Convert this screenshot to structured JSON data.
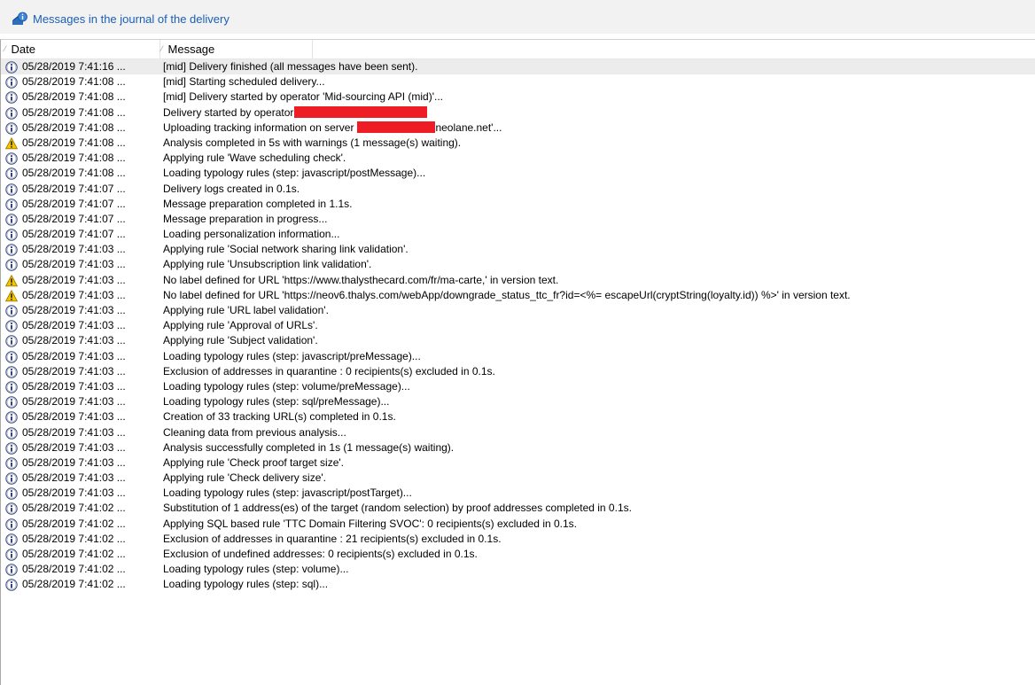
{
  "header": {
    "link_label": "Messages in the journal of the delivery",
    "icon": "delivery-info-icon"
  },
  "columns": {
    "date": "Date",
    "message": "Message"
  },
  "colors": {
    "link": "#1a5fb4",
    "info": "#2b3f8f",
    "warning": "#f5c400",
    "redaction": "#ee1c24",
    "selected_row": "#ececec"
  },
  "rows": [
    {
      "type": "info",
      "date": "05/28/2019 7:41:16 ...",
      "message": "[mid] Delivery finished (all messages have been sent)."
    },
    {
      "type": "info",
      "date": "05/28/2019 7:41:08 ...",
      "message": "[mid] Starting scheduled delivery..."
    },
    {
      "type": "info",
      "date": "05/28/2019 7:41:08 ...",
      "message": "[mid] Delivery started by operator 'Mid-sourcing API (mid)'..."
    },
    {
      "type": "info",
      "date": "05/28/2019 7:41:08 ...",
      "message": "Delivery started by operator",
      "redact_after": true
    },
    {
      "type": "info",
      "date": "05/28/2019 7:41:08 ...",
      "message": "Uploading tracking information on server",
      "redact_middle": true,
      "message_suffix": "neolane.net'..."
    },
    {
      "type": "warning",
      "date": "05/28/2019 7:41:08 ...",
      "message": "Analysis completed in 5s with warnings (1 message(s) waiting)."
    },
    {
      "type": "info",
      "date": "05/28/2019 7:41:08 ...",
      "message": "Applying rule 'Wave scheduling check'."
    },
    {
      "type": "info",
      "date": "05/28/2019 7:41:08 ...",
      "message": "Loading typology rules (step: javascript/postMessage)..."
    },
    {
      "type": "info",
      "date": "05/28/2019 7:41:07 ...",
      "message": "Delivery logs created in 0.1s."
    },
    {
      "type": "info",
      "date": "05/28/2019 7:41:07 ...",
      "message": "Message preparation completed in 1.1s."
    },
    {
      "type": "info",
      "date": "05/28/2019 7:41:07 ...",
      "message": "Message preparation in progress..."
    },
    {
      "type": "info",
      "date": "05/28/2019 7:41:07 ...",
      "message": "Loading personalization information..."
    },
    {
      "type": "info",
      "date": "05/28/2019 7:41:03 ...",
      "message": "Applying rule 'Social network sharing link validation'."
    },
    {
      "type": "info",
      "date": "05/28/2019 7:41:03 ...",
      "message": "Applying rule 'Unsubscription link validation'."
    },
    {
      "type": "warning",
      "date": "05/28/2019 7:41:03 ...",
      "message": "No label defined for URL 'https://www.thalysthecard.com/fr/ma-carte,' in version text."
    },
    {
      "type": "warning",
      "date": "05/28/2019 7:41:03 ...",
      "message": "No label defined for URL 'https://neov6.thalys.com/webApp/downgrade_status_ttc_fr?id=<%= escapeUrl(cryptString(loyalty.id)) %>' in version text."
    },
    {
      "type": "info",
      "date": "05/28/2019 7:41:03 ...",
      "message": "Applying rule 'URL label validation'."
    },
    {
      "type": "info",
      "date": "05/28/2019 7:41:03 ...",
      "message": "Applying rule 'Approval of URLs'."
    },
    {
      "type": "info",
      "date": "05/28/2019 7:41:03 ...",
      "message": "Applying rule 'Subject validation'."
    },
    {
      "type": "info",
      "date": "05/28/2019 7:41:03 ...",
      "message": "Loading typology rules (step: javascript/preMessage)..."
    },
    {
      "type": "info",
      "date": "05/28/2019 7:41:03 ...",
      "message": "Exclusion of addresses in quarantine : 0 recipients(s) excluded in 0.1s."
    },
    {
      "type": "info",
      "date": "05/28/2019 7:41:03 ...",
      "message": "Loading typology rules (step: volume/preMessage)..."
    },
    {
      "type": "info",
      "date": "05/28/2019 7:41:03 ...",
      "message": "Loading typology rules (step: sql/preMessage)..."
    },
    {
      "type": "info",
      "date": "05/28/2019 7:41:03 ...",
      "message": "Creation of 33 tracking URL(s) completed in 0.1s."
    },
    {
      "type": "info",
      "date": "05/28/2019 7:41:03 ...",
      "message": "Cleaning data from previous analysis..."
    },
    {
      "type": "info",
      "date": "05/28/2019 7:41:03 ...",
      "message": "Analysis successfully completed in 1s (1 message(s) waiting)."
    },
    {
      "type": "info",
      "date": "05/28/2019 7:41:03 ...",
      "message": "Applying rule 'Check proof target size'."
    },
    {
      "type": "info",
      "date": "05/28/2019 7:41:03 ...",
      "message": "Applying rule 'Check delivery size'."
    },
    {
      "type": "info",
      "date": "05/28/2019 7:41:03 ...",
      "message": "Loading typology rules (step: javascript/postTarget)..."
    },
    {
      "type": "info",
      "date": "05/28/2019 7:41:02 ...",
      "message": "Substitution of 1 address(es) of the target (random selection) by proof addresses completed in 0.1s."
    },
    {
      "type": "info",
      "date": "05/28/2019 7:41:02 ...",
      "message": "Applying SQL based rule 'TTC Domain Filtering SVOC': 0 recipients(s) excluded in 0.1s."
    },
    {
      "type": "info",
      "date": "05/28/2019 7:41:02 ...",
      "message": "Exclusion of addresses in quarantine : 21 recipients(s) excluded in 0.1s."
    },
    {
      "type": "info",
      "date": "05/28/2019 7:41:02 ...",
      "message": "Exclusion of undefined addresses: 0 recipients(s) excluded in 0.1s."
    },
    {
      "type": "info",
      "date": "05/28/2019 7:41:02 ...",
      "message": "Loading typology rules (step: volume)..."
    },
    {
      "type": "info",
      "date": "05/28/2019 7:41:02 ...",
      "message": "Loading typology rules (step: sql)..."
    }
  ]
}
